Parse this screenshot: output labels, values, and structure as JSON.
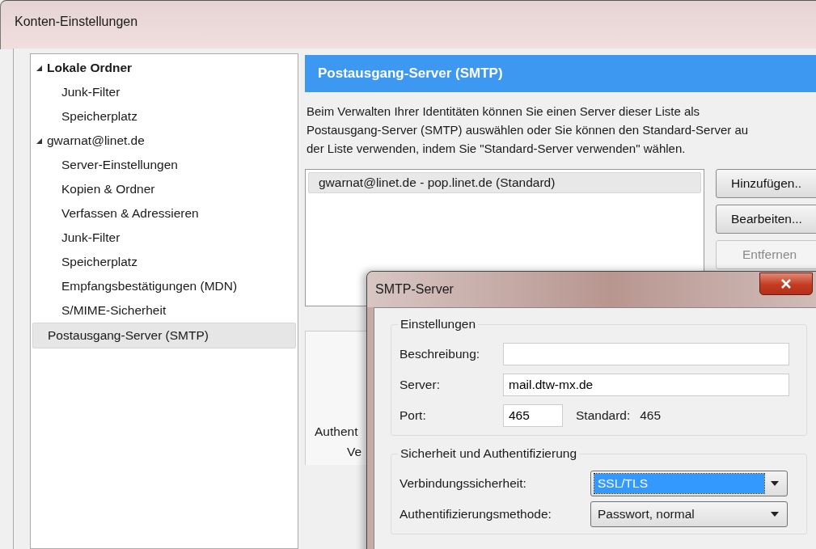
{
  "window": {
    "title": "Konten-Einstellungen"
  },
  "tree": [
    {
      "label": "Lokale Ordner",
      "bold": true,
      "selected": false,
      "expanded": true,
      "children": [
        {
          "label": "Junk-Filter",
          "selected": false
        },
        {
          "label": "Speicherplatz",
          "selected": false
        }
      ]
    },
    {
      "label": "gwarnat@linet.de",
      "bold": false,
      "selected": false,
      "expanded": true,
      "children": [
        {
          "label": "Server-Einstellungen",
          "selected": false
        },
        {
          "label": "Kopien & Ordner",
          "selected": false
        },
        {
          "label": "Verfassen & Adressieren",
          "selected": false
        },
        {
          "label": "Junk-Filter",
          "selected": false
        },
        {
          "label": "Speicherplatz",
          "selected": false
        },
        {
          "label": "Empfangsbestätigungen (MDN)",
          "selected": false
        },
        {
          "label": "S/MIME-Sicherheit",
          "selected": false
        }
      ]
    },
    {
      "label": "Postausgang-Server (SMTP)",
      "bold": false,
      "selected": true
    }
  ],
  "panel": {
    "title": "Postausgang-Server (SMTP)",
    "description": "Beim Verwalten Ihrer Identitäten können Sie einen Server dieser Liste als\nPostausgang-Server (SMTP) auswählen oder Sie können den Standard-Server au\nder Liste verwenden, indem Sie \"Standard-Server verwenden\" wählen.",
    "servers": [
      {
        "label": "gwarnat@linet.de - pop.linet.de (Standard)",
        "selected": true
      }
    ],
    "buttons": [
      {
        "label": "Hinzufügen..",
        "disabled": false
      },
      {
        "label": "Bearbeiten...",
        "disabled": false
      },
      {
        "label": "Entfernen",
        "disabled": true
      }
    ],
    "details": [
      "Authent",
      "Ve"
    ]
  },
  "dialog": {
    "title": "SMTP-Server",
    "groups": [
      {
        "title": "Einstellungen",
        "fields": [
          {
            "kind": "text",
            "label": "Beschreibung:"
          },
          {
            "kind": "text",
            "label": "Server:",
            "value": "mail.dtw-mx.de"
          },
          {
            "kind": "port",
            "label": "Port:",
            "value": "465",
            "default_label": "Standard:",
            "default_value": "465"
          }
        ]
      },
      {
        "title": "Sicherheit und Authentifizierung",
        "fields": [
          {
            "kind": "select",
            "label": "Verbindungssicherheit:",
            "value": "SSL/TLS",
            "focused": true
          },
          {
            "kind": "select",
            "label": "Authentifizierungsmethode:",
            "value": "Passwort, normal",
            "focused": false
          }
        ]
      }
    ]
  }
}
